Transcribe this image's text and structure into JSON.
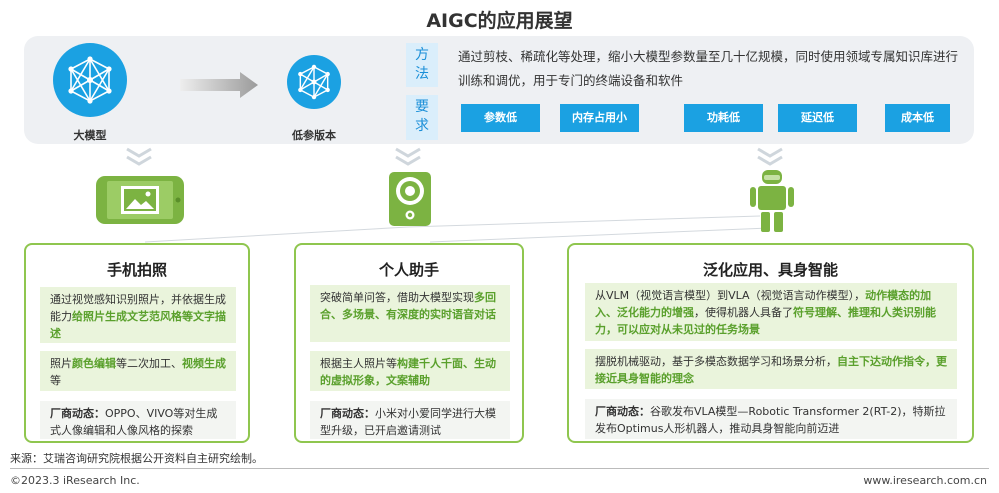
{
  "title": "AIGC的应用展望",
  "top": {
    "big_model_label": "大模型",
    "small_model_label": "低参版本",
    "method_tag": [
      "方",
      "法"
    ],
    "requirement_tag": [
      "要",
      "求"
    ],
    "method_text": "通过剪枝、稀疏化等处理，缩小大模型参数量至几十亿规模，同时使用领域专属知识库进行训练和调优，用于专门的终端设备和软件",
    "requirements": [
      "参数低",
      "内存占用小",
      "功耗低",
      "延迟低",
      "成本低"
    ]
  },
  "cards": [
    {
      "title": "手机拍照",
      "p1_a": "通过视觉感知识别照片，并依据生成能力",
      "p1_hl": "给照片生成文艺范风格等文字描述",
      "p2_a": "照片",
      "p2_hl1": "颜色编辑",
      "p2_b": "等二次加工、",
      "p2_hl2": "视频生成",
      "p2_c": "等",
      "p3_label": "厂商动态：",
      "p3_text": "OPPO、VIVO等对生成式人像编辑和人像风格的探索"
    },
    {
      "title": "个人助手",
      "p1_a": "突破简单问答，借助大模型实现",
      "p1_hl": "多回合、多场景、有深度的实时语音对话",
      "p2_a": "根据主人照片等",
      "p2_hl": "构建千人千面、生动的虚拟形象，文案辅助",
      "p3_label": "厂商动态：",
      "p3_text": "小米对小爱同学进行大模型升级，已开启邀请测试"
    },
    {
      "title": "泛化应用、具身智能",
      "p1_a": "从VLM（视觉语言模型）到VLA（视觉语言动作模型），",
      "p1_hl": "动作模态的加入、泛化能力的增强",
      "p1_b": "，使得机器人具备了",
      "p1_hl2": "符号理解、推理和人类识别能力，可以应对从未见过的任务场景",
      "p2_a": "摆脱机械驱动，基于多模态数据学习和场景分析，",
      "p2_hl": "自主下达动作指令，更接近具身智能的理念",
      "p3_label": "厂商动态：",
      "p3_text": "谷歌发布VLA模型—Robotic Transformer 2(RT-2)，特斯拉发布Optimus人形机器人，推动具身智能向前迈进"
    }
  ],
  "footer": {
    "source": "来源：艾瑞咨询研究院根据公开资料自主研究绘制。",
    "copyright": "©2023.3 iResearch Inc.",
    "website": "www.iresearch.com.cn"
  },
  "colors": {
    "blue": "#1ba1e2",
    "green": "#8fc64f",
    "highlight": "#5aa02c"
  },
  "icons": [
    "network-icon",
    "arrow-right-icon",
    "chevron-down-icon",
    "phone-image-icon",
    "speaker-icon",
    "robot-icon"
  ]
}
